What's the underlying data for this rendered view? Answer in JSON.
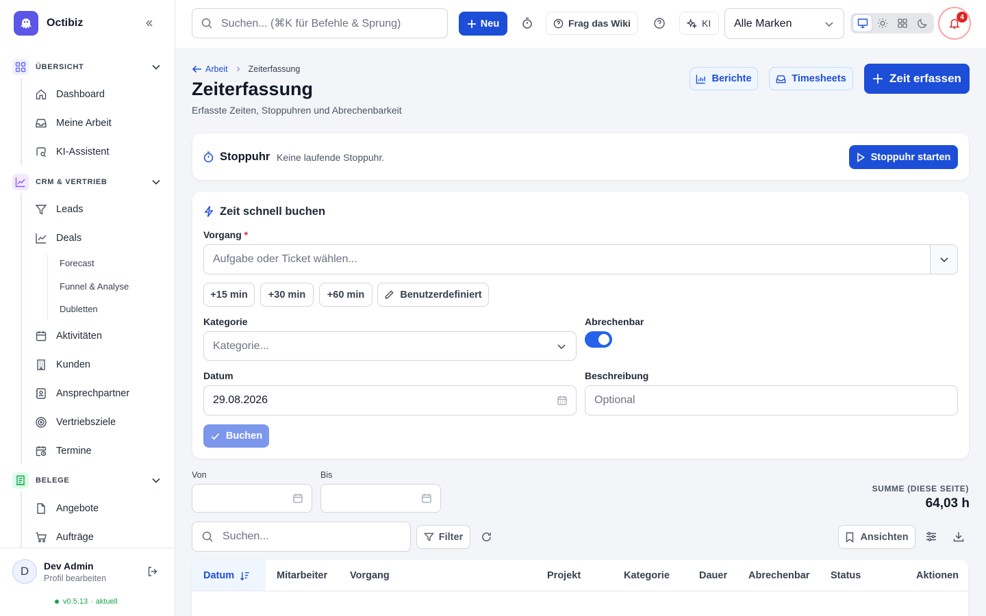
{
  "app": {
    "name": "Octibiz",
    "version": "v0.5.13",
    "version_status": "aktuell"
  },
  "sidebar": {
    "sections": [
      {
        "label": "ÜBERSICHT",
        "color": "#6366f1"
      },
      {
        "label": "CRM & VERTRIEB",
        "color": "#8b5cf6"
      },
      {
        "label": "BELEGE",
        "color": "#16a34a"
      }
    ],
    "items": {
      "dashboard": "Dashboard",
      "meine_arbeit": "Meine Arbeit",
      "ki_assistent": "KI-Assistent",
      "leads": "Leads",
      "deals": "Deals",
      "forecast": "Forecast",
      "funnel": "Funnel & Analyse",
      "dubletten": "Dubletten",
      "aktivitaeten": "Aktivitäten",
      "kunden": "Kunden",
      "ansprechpartner": "Ansprechpartner",
      "vertriebsziele": "Vertriebsziele",
      "termine": "Termine",
      "angebote": "Angebote",
      "auftraege": "Aufträge"
    },
    "user": {
      "initial": "D",
      "name": "Dev Admin",
      "sub": "Profil bearbeiten"
    }
  },
  "topbar": {
    "search_placeholder": "Suchen... (⌘K für Befehle & Sprung)",
    "new_label": "Neu",
    "wiki_label": "Frag das Wiki",
    "ki_label": "KI",
    "brand_select": "Alle Marken",
    "notification_count": "4"
  },
  "page": {
    "breadcrumb_back": "Arbeit",
    "breadcrumb_current": "Zeiterfassung",
    "title": "Zeiterfassung",
    "subtitle": "Erfasste Zeiten, Stoppuhren und Abrechenbarkeit",
    "reports_label": "Berichte",
    "timesheets_label": "Timesheets",
    "record_label": "Zeit erfassen"
  },
  "stopwatch": {
    "title": "Stoppuhr",
    "status": "Keine laufende Stoppuhr.",
    "start_label": "Stoppuhr starten"
  },
  "quick": {
    "title": "Zeit schnell buchen",
    "vorgang_label": "Vorgang",
    "required_mark": "*",
    "vorgang_placeholder": "Aufgabe oder Ticket wählen...",
    "chips": [
      "+15 min",
      "+30 min",
      "+60 min"
    ],
    "custom_label": "Benutzerdefiniert",
    "kategorie_label": "Kategorie",
    "kategorie_placeholder": "Kategorie...",
    "abrechenbar_label": "Abrechenbar",
    "abrechenbar_on": true,
    "datum_label": "Datum",
    "datum_value": "29.08.2026",
    "beschreibung_label": "Beschreibung",
    "beschreibung_placeholder": "Optional",
    "book_label": "Buchen"
  },
  "filters": {
    "von_label": "Von",
    "bis_label": "Bis",
    "sum_label": "SUMME (DIESE SEITE)",
    "sum_value": "64,03 h",
    "search_placeholder": "Suchen...",
    "filter_label": "Filter",
    "views_label": "Ansichten"
  },
  "table": {
    "columns": [
      "Datum",
      "Mitarbeiter",
      "Vorgang",
      "Projekt",
      "Kategorie",
      "Dauer",
      "Abrechenbar",
      "Status",
      "Aktionen"
    ]
  },
  "colors": {
    "primary": "#1d4ed8",
    "danger": "#dc2626",
    "success": "#16a34a"
  }
}
